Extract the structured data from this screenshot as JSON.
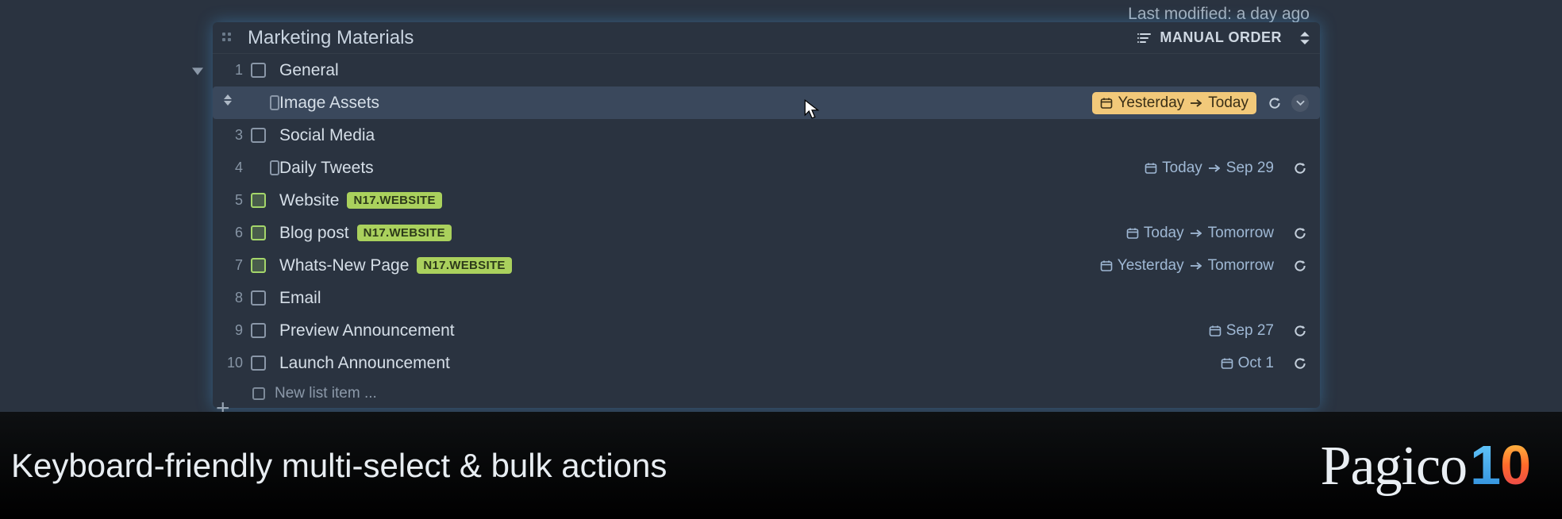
{
  "meta": {
    "last_modified": "Last modified: a day ago"
  },
  "list": {
    "title": "Marketing Materials",
    "order_label": "MANUAL ORDER",
    "new_item_placeholder": "New list item ...",
    "items": [
      {
        "num": "1",
        "label": "General",
        "indent": false,
        "green": false,
        "tag": null,
        "date": null,
        "highlight": false,
        "refresh": false,
        "expand": false,
        "selected": false
      },
      {
        "num": "",
        "label": "Image Assets",
        "indent": true,
        "green": false,
        "tag": null,
        "date": {
          "from": "Yesterday",
          "to": "Today"
        },
        "highlight": true,
        "refresh": true,
        "expand": true,
        "selected": true
      },
      {
        "num": "3",
        "label": "Social Media",
        "indent": false,
        "green": false,
        "tag": null,
        "date": null,
        "highlight": false,
        "refresh": false,
        "expand": false,
        "selected": false
      },
      {
        "num": "4",
        "label": "Daily Tweets",
        "indent": true,
        "green": false,
        "tag": null,
        "date": {
          "from": "Today",
          "to": "Sep 29"
        },
        "highlight": false,
        "refresh": true,
        "expand": false,
        "selected": false
      },
      {
        "num": "5",
        "label": "Website",
        "indent": false,
        "green": true,
        "tag": "N17.WEBSITE",
        "date": null,
        "highlight": false,
        "refresh": false,
        "expand": false,
        "selected": false
      },
      {
        "num": "6",
        "label": "Blog post",
        "indent": false,
        "green": true,
        "tag": "N17.WEBSITE",
        "date": {
          "from": "Today",
          "to": "Tomorrow"
        },
        "highlight": false,
        "refresh": true,
        "expand": false,
        "selected": false
      },
      {
        "num": "7",
        "label": "Whats-New Page",
        "indent": false,
        "green": true,
        "tag": "N17.WEBSITE",
        "date": {
          "from": "Yesterday",
          "to": "Tomorrow"
        },
        "highlight": false,
        "refresh": true,
        "expand": false,
        "selected": false
      },
      {
        "num": "8",
        "label": "Email",
        "indent": false,
        "green": false,
        "tag": null,
        "date": null,
        "highlight": false,
        "refresh": false,
        "expand": false,
        "selected": false
      },
      {
        "num": "9",
        "label": "Preview Announcement",
        "indent": false,
        "green": false,
        "tag": null,
        "date": {
          "single": "Sep 27"
        },
        "highlight": false,
        "refresh": true,
        "expand": false,
        "selected": false
      },
      {
        "num": "10",
        "label": "Launch Announcement",
        "indent": false,
        "green": false,
        "tag": null,
        "date": {
          "single": "Oct 1"
        },
        "highlight": false,
        "refresh": true,
        "expand": false,
        "selected": false
      }
    ]
  },
  "footer": {
    "tagline": "Keyboard-friendly multi-select & bulk actions",
    "product": "Pagico",
    "version_tens": "1",
    "version_ones": "0"
  }
}
